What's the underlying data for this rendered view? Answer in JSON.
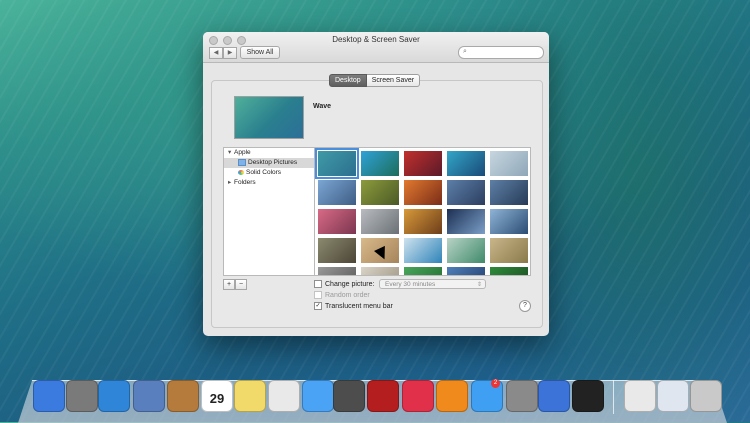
{
  "window": {
    "title": "Desktop & Screen Saver",
    "show_all_label": "Show All",
    "search_placeholder": "",
    "back_glyph": "◀",
    "forward_glyph": "▶"
  },
  "tabs": [
    {
      "label": "Desktop",
      "active": true
    },
    {
      "label": "Screen Saver",
      "active": false
    }
  ],
  "current_picture": {
    "name": "Wave"
  },
  "sources": {
    "apple_label": "Apple",
    "desktop_pictures_label": "Desktop Pictures",
    "solid_colors_label": "Solid Colors",
    "folders_label": "Folders"
  },
  "thumbnails": [
    {
      "c1": "#3f9aa6",
      "c2": "#2c6f8f"
    },
    {
      "c1": "#2fa2d8",
      "c2": "#1d6d5a"
    },
    {
      "c1": "#c2302c",
      "c2": "#5a1a2a"
    },
    {
      "c1": "#32a6c8",
      "c2": "#1a4a78"
    },
    {
      "c1": "#c6d6df",
      "c2": "#8fa7b9"
    },
    {
      "c1": "#7ca6d3",
      "c2": "#3d5d85"
    },
    {
      "c1": "#8c9b3c",
      "c2": "#4b5a25"
    },
    {
      "c1": "#e27a2f",
      "c2": "#7a2c18"
    },
    {
      "c1": "#5d7fa9",
      "c2": "#2b3e5f"
    },
    {
      "c1": "#5e7fa5",
      "c2": "#263b58"
    },
    {
      "c1": "#d96a86",
      "c2": "#7b3650"
    },
    {
      "c1": "#b8bcc0",
      "c2": "#6b7075"
    },
    {
      "c1": "#d89a3a",
      "c2": "#6d3d1a"
    },
    {
      "c1": "#1c2f52",
      "c2": "#7b9fc8"
    },
    {
      "c1": "#8fb4d6",
      "c2": "#2b4c74"
    },
    {
      "c1": "#8b8a6f",
      "c2": "#4b4536"
    },
    {
      "c1": "#d8b98a",
      "c2": "#a6855b"
    },
    {
      "c1": "#cfe2ee",
      "c2": "#2e84b9"
    },
    {
      "c1": "#b9d3c7",
      "c2": "#3f8a6a"
    },
    {
      "c1": "#c9b58a",
      "c2": "#8a7a4a"
    },
    {
      "c1": "#999999",
      "c2": "#555555"
    },
    {
      "c1": "#d9d4c8",
      "c2": "#9a8f7b"
    },
    {
      "c1": "#4aa55a",
      "c2": "#1f6a2f"
    },
    {
      "c1": "#4f7fb9",
      "c2": "#1f3a6a"
    },
    {
      "c1": "#2f8a3a",
      "c2": "#1a4a22"
    }
  ],
  "options": {
    "plus_label": "+",
    "minus_label": "−",
    "change_picture_label": "Change picture:",
    "change_picture_checked": false,
    "interval_value": "Every 30 minutes",
    "random_order_label": "Random order",
    "random_order_checked": false,
    "translucent_label": "Translucent menu bar",
    "translucent_checked": true,
    "help_label": "?"
  },
  "dock": {
    "items": [
      {
        "name": "finder",
        "color": "#3b7be0"
      },
      {
        "name": "launchpad",
        "color": "#7a7a7a"
      },
      {
        "name": "safari",
        "color": "#2f86d9"
      },
      {
        "name": "mail",
        "color": "#5a7fbf"
      },
      {
        "name": "contacts",
        "color": "#b57b3c"
      },
      {
        "name": "calendar",
        "color": "#ffffff"
      },
      {
        "name": "notes",
        "color": "#f2da6a"
      },
      {
        "name": "reminders",
        "color": "#e9e9e9"
      },
      {
        "name": "messages",
        "color": "#4aa3f5"
      },
      {
        "name": "facetime",
        "color": "#4d4d4d"
      },
      {
        "name": "photo-booth",
        "color": "#b41e1e"
      },
      {
        "name": "itunes",
        "color": "#e0304a"
      },
      {
        "name": "ibooks",
        "color": "#f08a1c"
      },
      {
        "name": "app-store",
        "color": "#3f9ff2"
      },
      {
        "name": "system-preferences",
        "color": "#8a8a8a"
      },
      {
        "name": "xcode",
        "color": "#3b73d8"
      },
      {
        "name": "terminal",
        "color": "#222222"
      },
      {
        "name": "document",
        "color": "#e9e9e9"
      },
      {
        "name": "mail-document",
        "color": "#dfe6ef"
      },
      {
        "name": "trash",
        "color": "#c9c9c9"
      }
    ],
    "calendar_day": "29",
    "app_store_badge": "2"
  }
}
